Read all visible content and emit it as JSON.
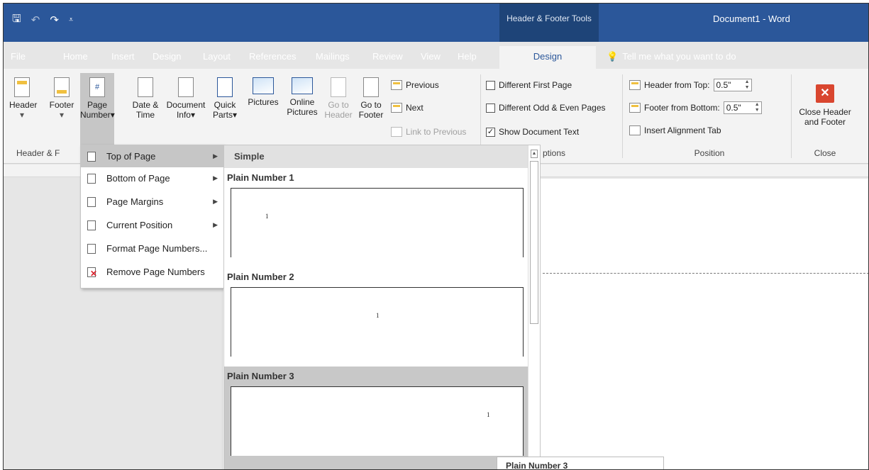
{
  "title_bar": {
    "contextual_tab_group": "Header & Footer Tools",
    "document_title": "Document1  -  Word"
  },
  "tabs": [
    {
      "label": "File"
    },
    {
      "label": "Home"
    },
    {
      "label": "Insert"
    },
    {
      "label": "Design"
    },
    {
      "label": "Layout"
    },
    {
      "label": "References"
    },
    {
      "label": "Mailings"
    },
    {
      "label": "Review"
    },
    {
      "label": "View"
    },
    {
      "label": "Help"
    },
    {
      "label": "Design"
    }
  ],
  "tell_me": "Tell me what you want to do",
  "ribbon": {
    "header_footer": {
      "header_label": "Header",
      "footer_label": "Footer",
      "page_number_line1": "Page",
      "page_number_line2": "Number",
      "group_label": "Header & F"
    },
    "insert": {
      "date_time_line1": "Date &",
      "date_time_line2": "Time",
      "doc_info_line1": "Document",
      "doc_info_line2": "Info",
      "quick_parts_line1": "Quick",
      "quick_parts_line2": "Parts",
      "pictures_label": "Pictures",
      "online_pictures_line1": "Online",
      "online_pictures_line2": "Pictures"
    },
    "navigation": {
      "goto_header_line1": "Go to",
      "goto_header_line2": "Header",
      "goto_footer_line1": "Go to",
      "goto_footer_line2": "Footer",
      "previous_label": "Previous",
      "next_label": "Next",
      "link_previous_label": "Link to Previous"
    },
    "options": {
      "different_first_page": "Different First Page",
      "different_odd_even": "Different Odd & Even Pages",
      "show_document_text": "Show Document Text",
      "group_label": "ptions"
    },
    "position": {
      "header_from_top_label": "Header from Top:",
      "header_from_top_value": "0.5\"",
      "footer_from_bottom_label": "Footer from Bottom:",
      "footer_from_bottom_value": "0.5\"",
      "insert_alignment_tab": "Insert Alignment Tab",
      "group_label": "Position"
    },
    "close": {
      "close_line1": "Close Header",
      "close_line2": "and Footer",
      "group_label": "Close"
    }
  },
  "page_number_menu": {
    "items": [
      {
        "label": "Top of Page"
      },
      {
        "label": "Bottom of Page"
      },
      {
        "label": "Page Margins"
      },
      {
        "label": "Current Position"
      },
      {
        "label": "Format Page Numbers..."
      },
      {
        "label": "Remove Page Numbers"
      }
    ]
  },
  "gallery": {
    "section_header": "Simple",
    "items": [
      {
        "title": "Plain Number 1",
        "sample": "1"
      },
      {
        "title": "Plain Number 2",
        "sample": "1"
      },
      {
        "title": "Plain Number 3",
        "sample": "1"
      }
    ],
    "tooltip": "Plain Number 3"
  }
}
